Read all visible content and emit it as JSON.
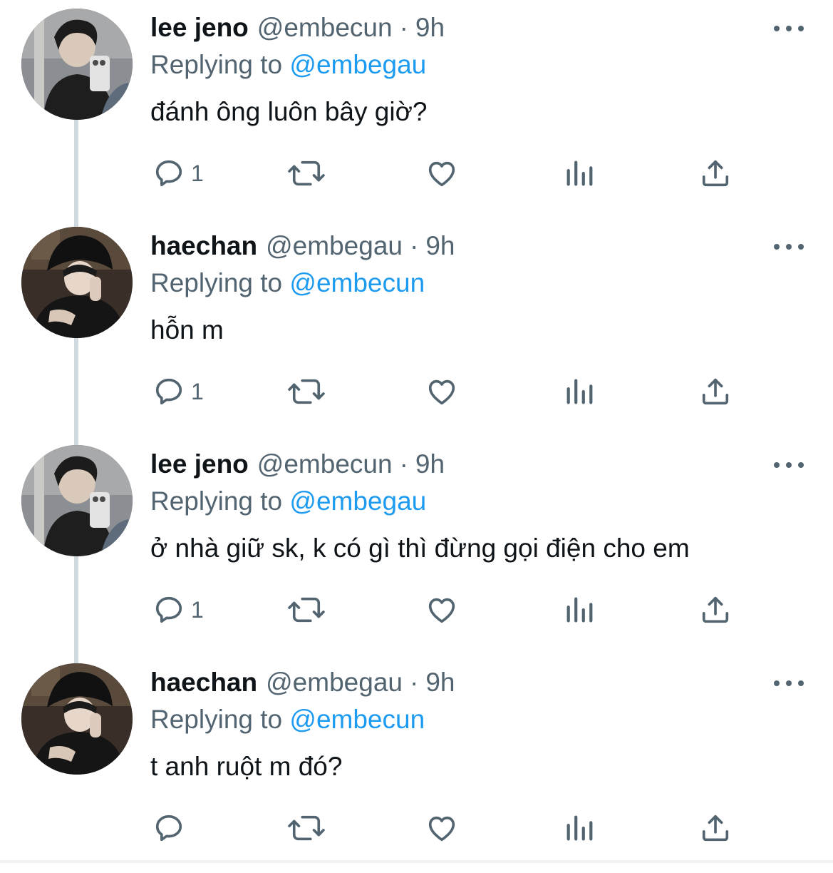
{
  "tweets": [
    {
      "display_name": "lee jeno",
      "handle": "@embecun",
      "separator": "·",
      "time": "9h",
      "replying_prefix": "Replying to",
      "replying_to": "@embegau",
      "text": "đánh ông luôn bây giờ?",
      "reply_count": "1",
      "avatar": "avatar-lee-jeno"
    },
    {
      "display_name": "haechan",
      "handle": "@embegau",
      "separator": "·",
      "time": "9h",
      "replying_prefix": "Replying to",
      "replying_to": "@embecun",
      "text": "hỗn m",
      "reply_count": "1",
      "avatar": "avatar-haechan"
    },
    {
      "display_name": "lee jeno",
      "handle": "@embecun",
      "separator": "·",
      "time": "9h",
      "replying_prefix": "Replying to",
      "replying_to": "@embegau",
      "text": "ở nhà giữ sk, k có gì thì đừng gọi điện cho em",
      "reply_count": "1",
      "avatar": "avatar-lee-jeno"
    },
    {
      "display_name": "haechan",
      "handle": "@embegau",
      "separator": "·",
      "time": "9h",
      "replying_prefix": "Replying to",
      "replying_to": "@embecun",
      "text": "t anh ruột m đó?",
      "reply_count": "",
      "avatar": "avatar-haechan"
    }
  ],
  "icons": {
    "reply": "reply-icon",
    "retweet": "retweet-icon",
    "like": "like-icon",
    "analytics": "analytics-icon",
    "share": "share-icon",
    "more": "more-options-icon"
  },
  "colors": {
    "text_primary": "#0f1419",
    "text_secondary": "#536471",
    "mention": "#1d9bf0",
    "thread_line": "#cfd9de"
  }
}
